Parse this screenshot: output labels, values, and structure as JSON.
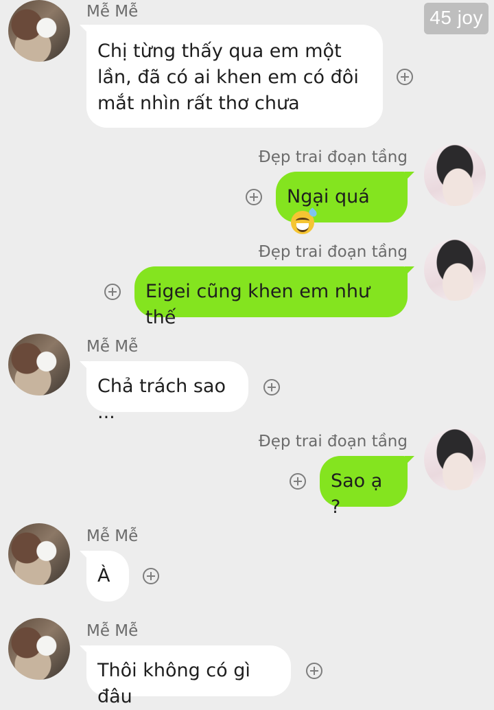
{
  "watermark": "45 joy",
  "her_name": "Mễ Mễ",
  "his_name": "Đẹp trai đoạn tầng",
  "messages": [
    {
      "from": "her",
      "line1": "Chị từng thấy qua em một",
      "line2": "lần, đã có ai khen em có đôi",
      "line3": "mắt nhìn rất thơ chưa"
    },
    {
      "from": "him",
      "text": "Ngại quá",
      "emoji": "grinning-sweat-emoji"
    },
    {
      "from": "him",
      "text": "Eigei cũng khen em như thế"
    },
    {
      "from": "her",
      "text": "Chả trách sao ..."
    },
    {
      "from": "him",
      "text": "Sao ạ ?"
    },
    {
      "from": "her",
      "text": "À"
    },
    {
      "from": "her",
      "text": "Thôi không có gì đâu"
    }
  ],
  "colors": {
    "background": "#ededed",
    "sent_bubble": "#84e41f",
    "received_bubble": "#ffffff"
  }
}
